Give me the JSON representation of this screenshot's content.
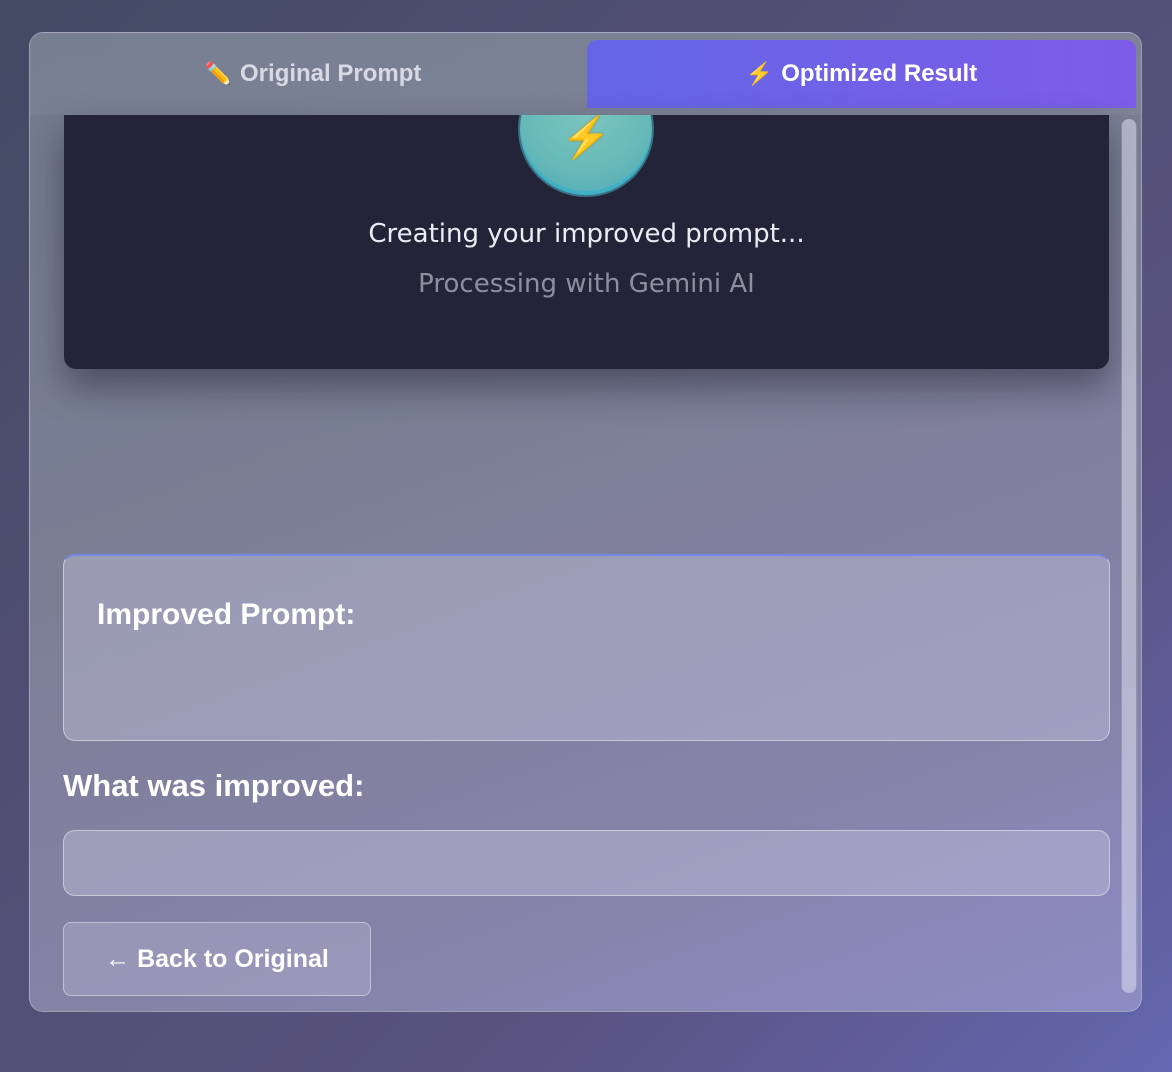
{
  "tabs": {
    "original": {
      "icon": "✏️",
      "icon_name": "pencil-icon",
      "label": "Original Prompt"
    },
    "optimized": {
      "icon": "⚡",
      "icon_name": "lightning-icon",
      "label": "Optimized Result",
      "active": true
    }
  },
  "loading": {
    "icon": "⚡",
    "icon_name": "lightning-icon",
    "title": "Creating your improved prompt...",
    "subtitle": "Processing with Gemini AI"
  },
  "improved_prompt": {
    "label": "Improved Prompt:",
    "value": ""
  },
  "improvements": {
    "label": "What was improved:",
    "value": ""
  },
  "back_button": {
    "label": "← Back to Original"
  },
  "colors": {
    "accent_start": "#6466e6",
    "accent_end": "#7c5ce8",
    "loading_card_bg": "#232438"
  }
}
